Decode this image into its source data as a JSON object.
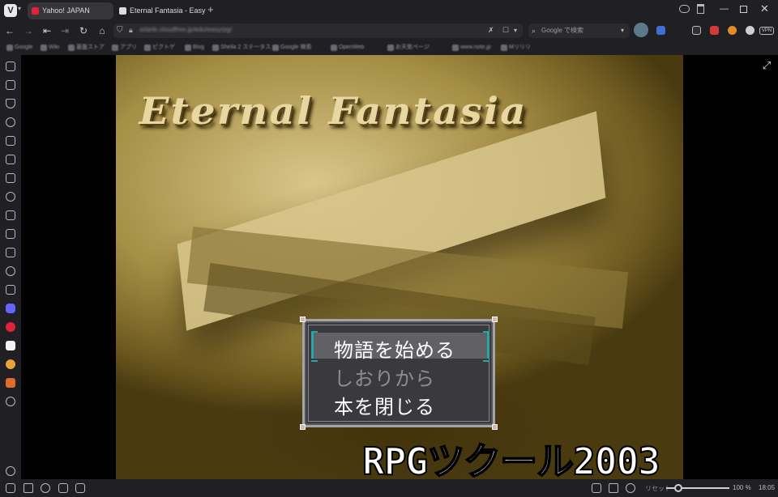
{
  "tabs": [
    {
      "label": "Yahoo! JAPAN",
      "favicon": "yahoo-icon",
      "color": "#e0223b",
      "active": false
    },
    {
      "label": "Eternal Fantasia - EasyRPG",
      "favicon": "page-icon",
      "color": "#dcdce0",
      "active": true
    }
  ],
  "addressbar": {
    "url": "arlarle.cloudfree.jp/edu/easyrpg/",
    "search_placeholder": "Google で検索"
  },
  "bookmarks": [
    "Google",
    "Wiki",
    "基盤ストア",
    "アプリ",
    "ピクトゲ",
    "Blog",
    "Sheila 2 ステータス",
    "Google 検索",
    "OpenWeb",
    "お天気ページ",
    "www.note.jp",
    "Mリリリ"
  ],
  "game": {
    "title": "Eternal Fantasia",
    "menu": [
      {
        "label": "物語を始める",
        "enabled": true,
        "selected": true
      },
      {
        "label": "しおりから",
        "enabled": false,
        "selected": false
      },
      {
        "label": "本を閉じる",
        "enabled": true,
        "selected": false
      }
    ],
    "logo": "RPGツクール2003"
  },
  "statusbar": {
    "reset_label": "リセット",
    "zoom": "100 %",
    "clock": "18:05"
  },
  "colors": {
    "chrome_bg": "#202024",
    "cursor_accent": "#26a6a6"
  }
}
